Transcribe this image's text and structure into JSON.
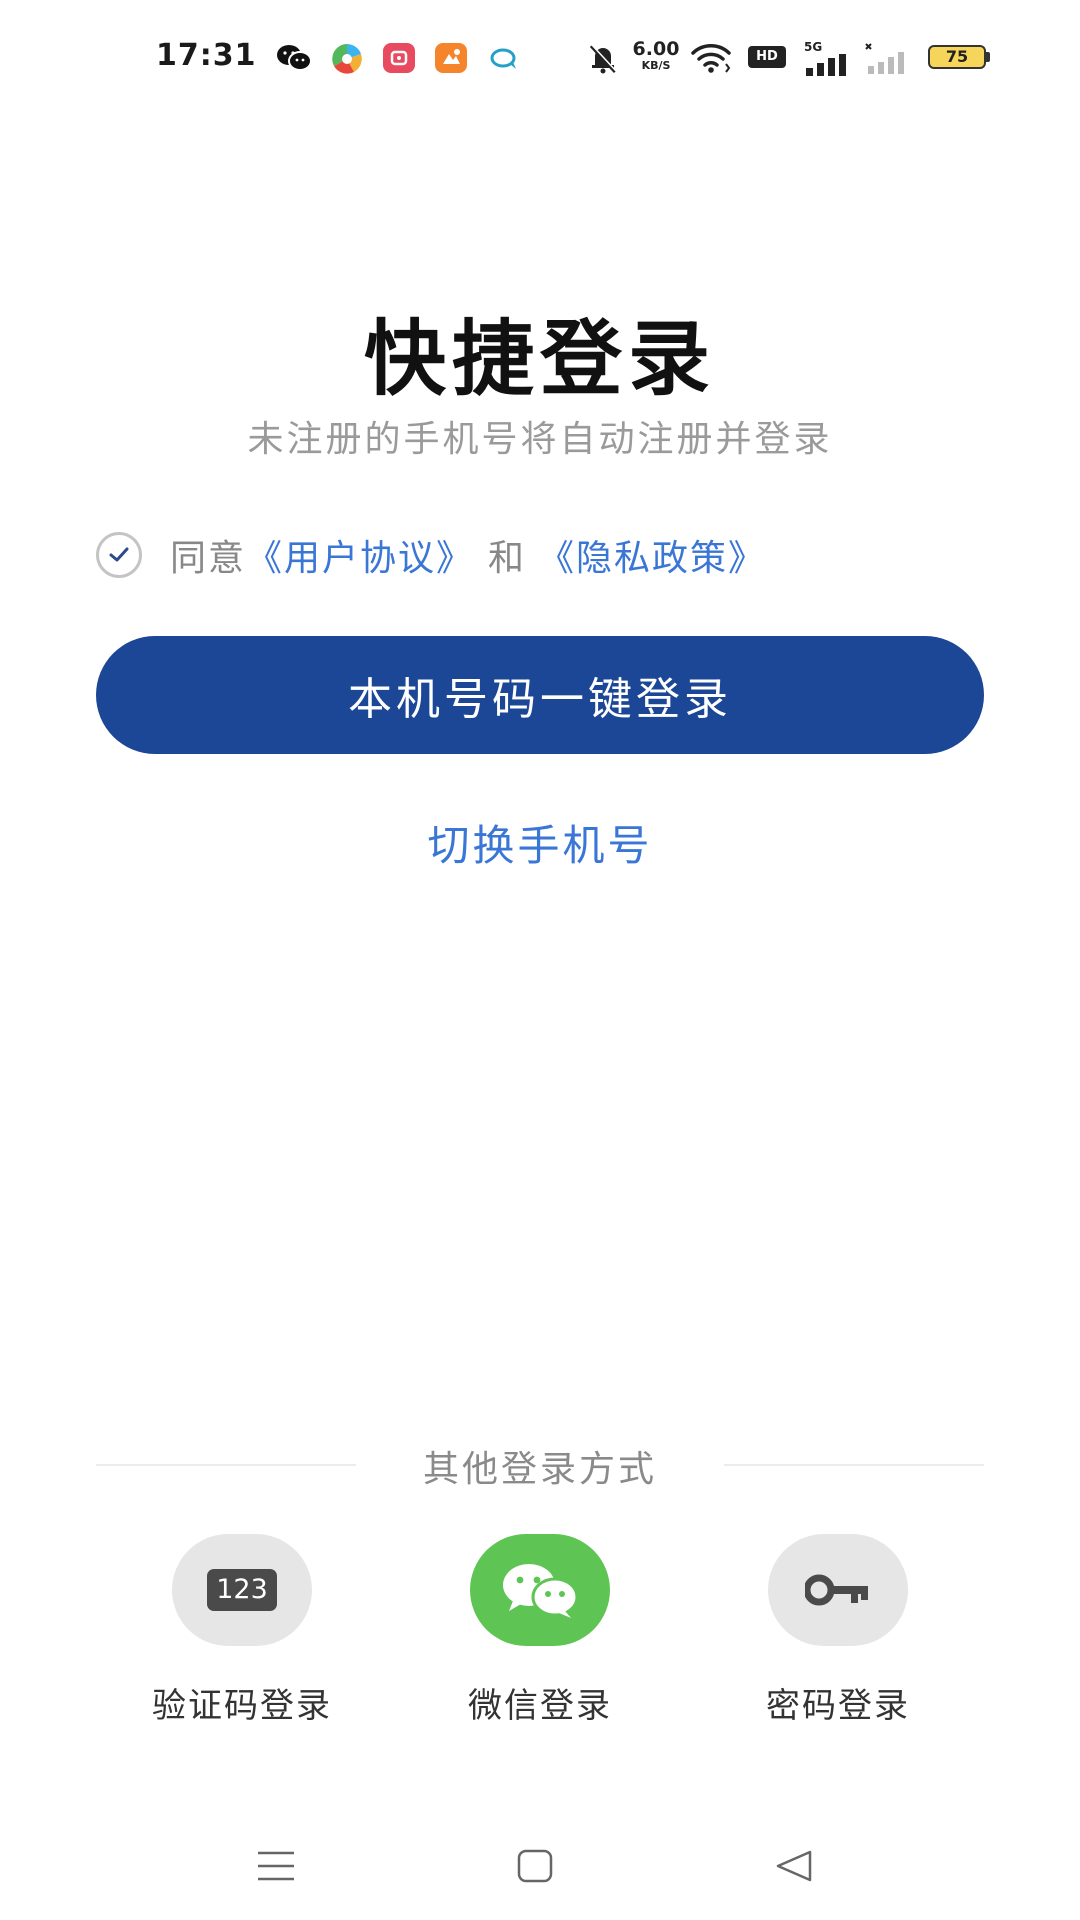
{
  "status_bar": {
    "time": "17:31",
    "net_speed_value": "6.00",
    "net_speed_unit": "KB/S",
    "hd_label": "HD",
    "net_type": "5G",
    "battery_level": "75",
    "icons": [
      "wechat-icon",
      "pinwheel-app-icon",
      "red-app-icon",
      "orange-app-icon",
      "cloud-chat-icon",
      "mute-bell-icon",
      "wifi-icon",
      "hd-icon",
      "signal-5g-icon",
      "signal-weak-icon",
      "battery-icon"
    ]
  },
  "login": {
    "title": "快捷登录",
    "subtitle": "未注册的手机号将自动注册并登录",
    "agree_prefix": "同意",
    "user_agreement": "《用户协议》",
    "and_word": "和",
    "privacy_policy": "《隐私政策》",
    "agreement_checked": true,
    "one_click_button": "本机号码一键登录",
    "switch_phone": "切换手机号"
  },
  "other_methods": {
    "label": "其他登录方式",
    "items": [
      {
        "label": "验证码登录",
        "icon": "code-123-icon",
        "badge": "123"
      },
      {
        "label": "微信登录",
        "icon": "wechat-icon"
      },
      {
        "label": "密码登录",
        "icon": "key-icon"
      }
    ]
  },
  "nav_bar": {
    "icons": [
      "menu-icon",
      "home-icon",
      "back-icon"
    ]
  },
  "colors": {
    "primary_button": "#1c4796",
    "link_blue": "#3a76d6",
    "wechat_green": "#5ec554",
    "method_gray": "#e6e6e6",
    "battery_yellow": "#f5d65a"
  }
}
